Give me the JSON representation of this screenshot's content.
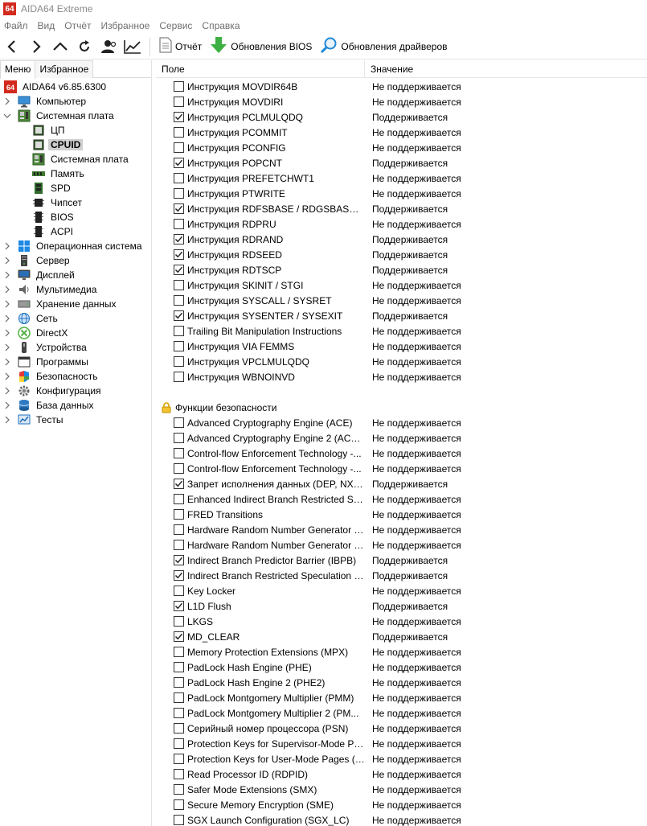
{
  "window": {
    "logo_text": "64",
    "title": "AIDA64 Extreme"
  },
  "menubar": {
    "items": [
      "Файл",
      "Вид",
      "Отчёт",
      "Избранное",
      "Сервис",
      "Справка"
    ]
  },
  "toolbar": {
    "report_label": "Отчёт",
    "bios_label": "Обновления BIOS",
    "drivers_label": "Обновления драйверов"
  },
  "left_panel": {
    "tabs": [
      "Меню",
      "Избранное"
    ],
    "tree": [
      {
        "label": "AIDA64 v6.85.6300",
        "level": 0,
        "icon": "aida64-logo-icon",
        "arrow": "none"
      },
      {
        "label": "Компьютер",
        "level": 0,
        "icon": "computer-icon",
        "arrow": "collapsed"
      },
      {
        "label": "Системная плата",
        "level": 0,
        "icon": "motherboard-icon",
        "arrow": "expanded"
      },
      {
        "label": "ЦП",
        "level": 1,
        "icon": "cpu-icon",
        "arrow": "none"
      },
      {
        "label": "CPUID",
        "level": 1,
        "icon": "cpuid-icon",
        "arrow": "none",
        "selected": true
      },
      {
        "label": "Системная плата",
        "level": 1,
        "icon": "motherboard-icon",
        "arrow": "none"
      },
      {
        "label": "Память",
        "level": 1,
        "icon": "memory-icon",
        "arrow": "none"
      },
      {
        "label": "SPD",
        "level": 1,
        "icon": "spd-icon",
        "arrow": "none"
      },
      {
        "label": "Чипсет",
        "level": 1,
        "icon": "chipset-icon",
        "arrow": "none"
      },
      {
        "label": "BIOS",
        "level": 1,
        "icon": "bios-icon",
        "arrow": "none"
      },
      {
        "label": "ACPI",
        "level": 1,
        "icon": "acpi-icon",
        "arrow": "none"
      },
      {
        "label": "Операционная система",
        "level": 0,
        "icon": "windows-icon",
        "arrow": "collapsed"
      },
      {
        "label": "Сервер",
        "level": 0,
        "icon": "server-icon",
        "arrow": "collapsed"
      },
      {
        "label": "Дисплей",
        "level": 0,
        "icon": "display-icon",
        "arrow": "collapsed"
      },
      {
        "label": "Мультимедиа",
        "level": 0,
        "icon": "speaker-icon",
        "arrow": "collapsed"
      },
      {
        "label": "Хранение данных",
        "level": 0,
        "icon": "storage-icon",
        "arrow": "collapsed"
      },
      {
        "label": "Сеть",
        "level": 0,
        "icon": "network-icon",
        "arrow": "collapsed"
      },
      {
        "label": "DirectX",
        "level": 0,
        "icon": "directx-icon",
        "arrow": "collapsed"
      },
      {
        "label": "Устройства",
        "level": 0,
        "icon": "devices-icon",
        "arrow": "collapsed"
      },
      {
        "label": "Программы",
        "level": 0,
        "icon": "programs-icon",
        "arrow": "collapsed"
      },
      {
        "label": "Безопасность",
        "level": 0,
        "icon": "shield-icon",
        "arrow": "collapsed"
      },
      {
        "label": "Конфигурация",
        "level": 0,
        "icon": "gear-icon",
        "arrow": "collapsed"
      },
      {
        "label": "База данных",
        "level": 0,
        "icon": "database-icon",
        "arrow": "collapsed"
      },
      {
        "label": "Тесты",
        "level": 0,
        "icon": "benchmark-icon",
        "arrow": "collapsed"
      }
    ]
  },
  "table": {
    "headers": {
      "field": "Поле",
      "value": "Значение"
    },
    "rows_top": [
      {
        "field": "Инструкция MOVDIR64B",
        "value": "Не поддерживается",
        "checked": false
      },
      {
        "field": "Инструкция MOVDIRI",
        "value": "Не поддерживается",
        "checked": false
      },
      {
        "field": "Инструкция PCLMULQDQ",
        "value": "Поддерживается",
        "checked": true
      },
      {
        "field": "Инструкция PCOMMIT",
        "value": "Не поддерживается",
        "checked": false
      },
      {
        "field": "Инструкция PCONFIG",
        "value": "Не поддерживается",
        "checked": false
      },
      {
        "field": "Инструкция POPCNT",
        "value": "Поддерживается",
        "checked": true
      },
      {
        "field": "Инструкция PREFETCHWT1",
        "value": "Не поддерживается",
        "checked": false
      },
      {
        "field": "Инструкция PTWRITE",
        "value": "Не поддерживается",
        "checked": false
      },
      {
        "field": "Инструкция RDFSBASE / RDGSBASE / ...",
        "value": "Поддерживается",
        "checked": true
      },
      {
        "field": "Инструкция RDPRU",
        "value": "Не поддерживается",
        "checked": false
      },
      {
        "field": "Инструкция RDRAND",
        "value": "Поддерживается",
        "checked": true
      },
      {
        "field": "Инструкция RDSEED",
        "value": "Поддерживается",
        "checked": true
      },
      {
        "field": "Инструкция RDTSCP",
        "value": "Поддерживается",
        "checked": true
      },
      {
        "field": "Инструкция SKINIT / STGI",
        "value": "Не поддерживается",
        "checked": false
      },
      {
        "field": "Инструкция SYSCALL / SYSRET",
        "value": "Не поддерживается",
        "checked": false
      },
      {
        "field": "Инструкция SYSENTER / SYSEXIT",
        "value": "Поддерживается",
        "checked": true
      },
      {
        "field": "Trailing Bit Manipulation Instructions",
        "value": "Не поддерживается",
        "checked": false
      },
      {
        "field": "Инструкция VIA FEMMS",
        "value": "Не поддерживается",
        "checked": false
      },
      {
        "field": "Инструкция VPCLMULQDQ",
        "value": "Не поддерживается",
        "checked": false
      },
      {
        "field": "Инструкция WBNOINVD",
        "value": "Не поддерживается",
        "checked": false
      }
    ],
    "group_label": "Функции безопасности",
    "rows_security": [
      {
        "field": "Advanced Cryptography Engine (ACE)",
        "value": "Не поддерживается",
        "checked": false
      },
      {
        "field": "Advanced Cryptography Engine 2 (ACE2)",
        "value": "Не поддерживается",
        "checked": false
      },
      {
        "field": "Control-flow Enforcement Technology -...",
        "value": "Не поддерживается",
        "checked": false
      },
      {
        "field": "Control-flow Enforcement Technology -...",
        "value": "Не поддерживается",
        "checked": false
      },
      {
        "field": "Запрет исполнения данных (DEP, NX, ...",
        "value": "Поддерживается",
        "checked": true
      },
      {
        "field": "Enhanced Indirect Branch Restricted Sp...",
        "value": "Не поддерживается",
        "checked": false
      },
      {
        "field": "FRED Transitions",
        "value": "Не поддерживается",
        "checked": false
      },
      {
        "field": "Hardware Random Number Generator (...",
        "value": "Не поддерживается",
        "checked": false
      },
      {
        "field": "Hardware Random Number Generator 2...",
        "value": "Не поддерживается",
        "checked": false
      },
      {
        "field": "Indirect Branch Predictor Barrier (IBPB)",
        "value": "Поддерживается",
        "checked": true
      },
      {
        "field": "Indirect Branch Restricted Speculation (I...",
        "value": "Поддерживается",
        "checked": true
      },
      {
        "field": "Key Locker",
        "value": "Не поддерживается",
        "checked": false
      },
      {
        "field": "L1D Flush",
        "value": "Поддерживается",
        "checked": true
      },
      {
        "field": "LKGS",
        "value": "Не поддерживается",
        "checked": false
      },
      {
        "field": "MD_CLEAR",
        "value": "Поддерживается",
        "checked": true
      },
      {
        "field": "Memory Protection Extensions (MPX)",
        "value": "Не поддерживается",
        "checked": false
      },
      {
        "field": "PadLock Hash Engine (PHE)",
        "value": "Не поддерживается",
        "checked": false
      },
      {
        "field": "PadLock Hash Engine 2 (PHE2)",
        "value": "Не поддерживается",
        "checked": false
      },
      {
        "field": "PadLock Montgomery Multiplier (PMM)",
        "value": "Не поддерживается",
        "checked": false
      },
      {
        "field": "PadLock Montgomery Multiplier 2 (PM...",
        "value": "Не поддерживается",
        "checked": false
      },
      {
        "field": "Серийный номер процессора (PSN)",
        "value": "Не поддерживается",
        "checked": false
      },
      {
        "field": "Protection Keys for Supervisor-Mode Pa...",
        "value": "Не поддерживается",
        "checked": false
      },
      {
        "field": "Protection Keys for User-Mode Pages (P...",
        "value": "Не поддерживается",
        "checked": false
      },
      {
        "field": "Read Processor ID (RDPID)",
        "value": "Не поддерживается",
        "checked": false
      },
      {
        "field": "Safer Mode Extensions (SMX)",
        "value": "Не поддерживается",
        "checked": false
      },
      {
        "field": "Secure Memory Encryption (SME)",
        "value": "Не поддерживается",
        "checked": false
      },
      {
        "field": "SGX Launch Configuration (SGX_LC)",
        "value": "Не поддерживается",
        "checked": false
      }
    ]
  }
}
